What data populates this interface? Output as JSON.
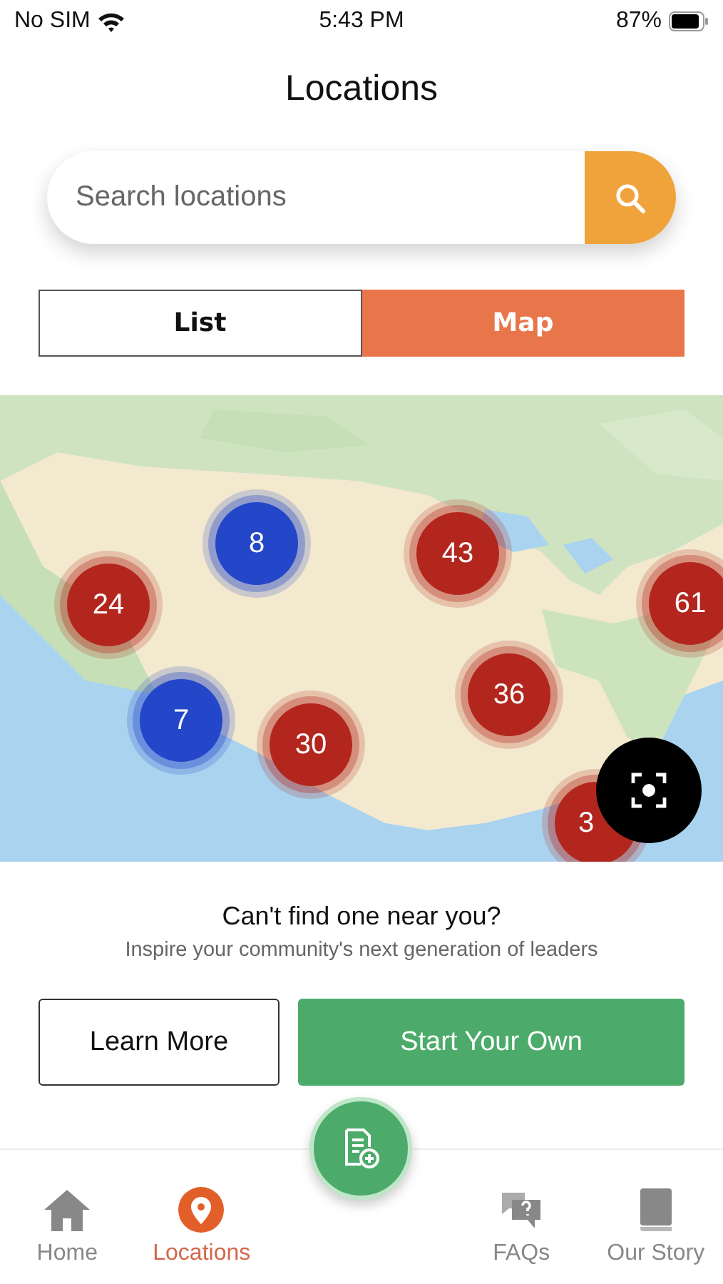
{
  "status_bar": {
    "carrier": "No SIM",
    "time": "5:43 PM",
    "battery": "87%"
  },
  "title": "Locations",
  "search": {
    "placeholder": "Search locations"
  },
  "view_toggle": [
    {
      "label": "List",
      "selected": false
    },
    {
      "label": "Map",
      "selected": true
    }
  ],
  "map": {
    "kind": "picture",
    "clusters": [
      {
        "count": "8",
        "color": "#2446c8"
      },
      {
        "count": "43",
        "color": "#b3261e"
      },
      {
        "count": "24",
        "color": "#b3261e"
      },
      {
        "count": "61",
        "color": "#b3261e"
      },
      {
        "count": "7",
        "color": "#2446c8"
      },
      {
        "count": "30",
        "color": "#b3261e"
      },
      {
        "count": "36",
        "color": "#b3261e"
      },
      {
        "count": "3",
        "color": "#b3261e"
      }
    ]
  },
  "prompt": {
    "heading": "Can't find one near you?",
    "subtext": "Inspire your community's next generation of leaders"
  },
  "buttons": [
    {
      "label": "Learn More",
      "kind": "outline"
    },
    {
      "label": "Start Your Own",
      "kind": "filled"
    }
  ],
  "tab_bar": [
    {
      "label": "Home",
      "kind": "home",
      "selected": false
    },
    {
      "label": "Locations",
      "kind": "pin",
      "selected": true
    },
    {
      "label": "FAQs",
      "kind": "faq",
      "selected": false
    },
    {
      "label": "Our Story",
      "kind": "book",
      "selected": false
    }
  ]
}
